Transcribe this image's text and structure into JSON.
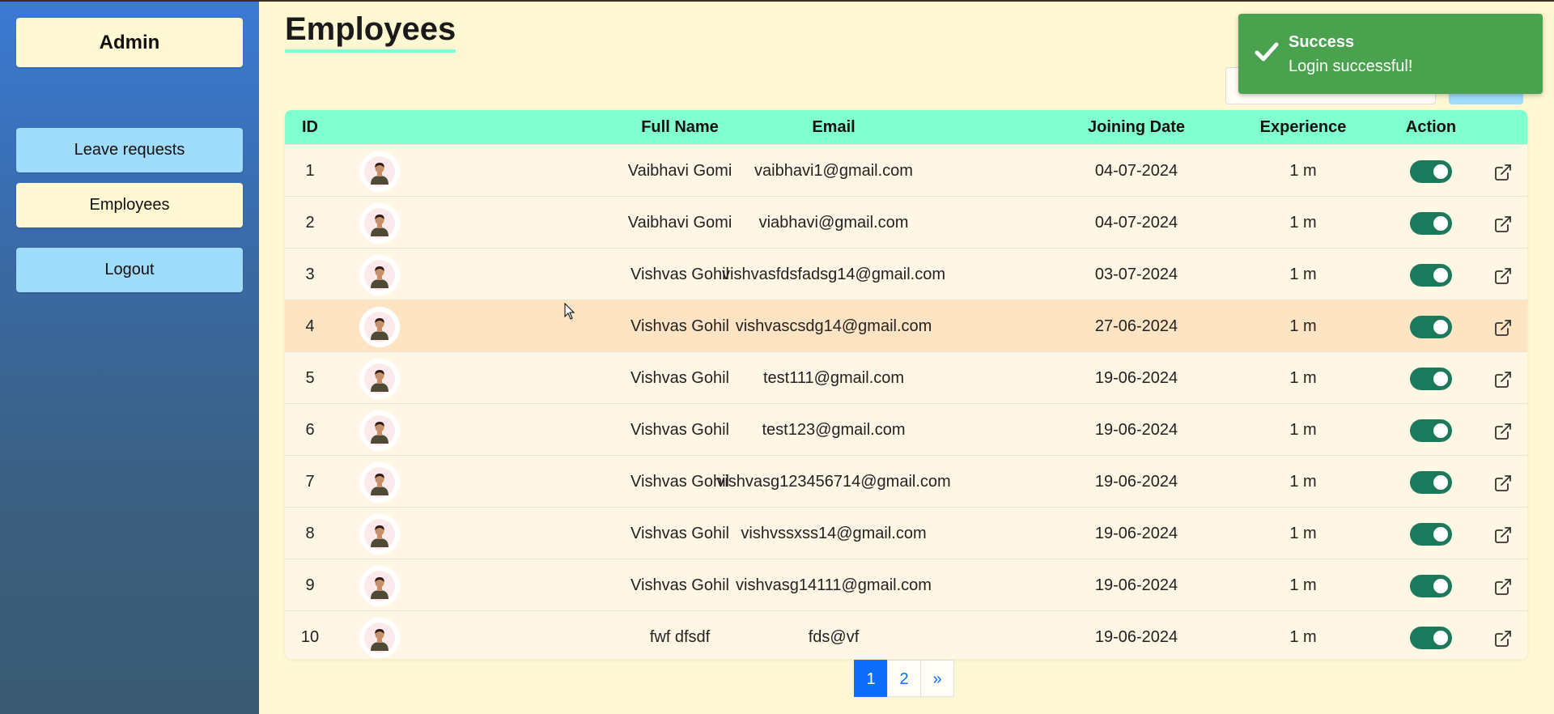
{
  "sidebar": {
    "title": "Admin",
    "items": [
      {
        "label": "Leave requests"
      },
      {
        "label": "Employees"
      },
      {
        "label": "Logout"
      }
    ]
  },
  "page": {
    "title": "Employees"
  },
  "toast": {
    "title": "Success",
    "message": "Login successful!",
    "color": "#4aa24e"
  },
  "table": {
    "headers": [
      "ID",
      "Full Name",
      "Email",
      "Joining Date",
      "Experience",
      "Action"
    ],
    "rows": [
      {
        "id": "1",
        "name": "Vaibhavi Gomi",
        "email": "vaibhavi1@gmail.com",
        "date": "04-07-2024",
        "exp": "1 m"
      },
      {
        "id": "2",
        "name": "Vaibhavi Gomi",
        "email": "viabhavi@gmail.com",
        "date": "04-07-2024",
        "exp": "1 m"
      },
      {
        "id": "3",
        "name": "Vishvas Gohil",
        "email": "vishvasfdsfadsg14@gmail.com",
        "date": "03-07-2024",
        "exp": "1 m"
      },
      {
        "id": "4",
        "name": "Vishvas Gohil",
        "email": "vishvascsdg14@gmail.com",
        "date": "27-06-2024",
        "exp": "1 m"
      },
      {
        "id": "5",
        "name": "Vishvas Gohil",
        "email": "test111@gmail.com",
        "date": "19-06-2024",
        "exp": "1 m"
      },
      {
        "id": "6",
        "name": "Vishvas Gohil",
        "email": "test123@gmail.com",
        "date": "19-06-2024",
        "exp": "1 m"
      },
      {
        "id": "7",
        "name": "Vishvas Gohil",
        "email": "vishvasg123456714@gmail.com",
        "date": "19-06-2024",
        "exp": "1 m"
      },
      {
        "id": "8",
        "name": "Vishvas Gohil",
        "email": "vishvssxss14@gmail.com",
        "date": "19-06-2024",
        "exp": "1 m"
      },
      {
        "id": "9",
        "name": "Vishvas Gohil",
        "email": "vishvasg14111@gmail.com",
        "date": "19-06-2024",
        "exp": "1 m"
      },
      {
        "id": "10",
        "name": "fwf dfsdf",
        "email": "fds@vf",
        "date": "19-06-2024",
        "exp": "1 m"
      }
    ],
    "highlighted_row": 4,
    "toggle_color": "#1a7a5c",
    "header_color": "#80ffd0"
  },
  "pagination": {
    "pages": [
      "1",
      "2"
    ],
    "next": "»",
    "current": "1"
  },
  "icons": {
    "toast": "check-icon",
    "action_toggle": "toggle-switch",
    "action_open": "external-link-icon",
    "avatar": "user-avatar"
  }
}
